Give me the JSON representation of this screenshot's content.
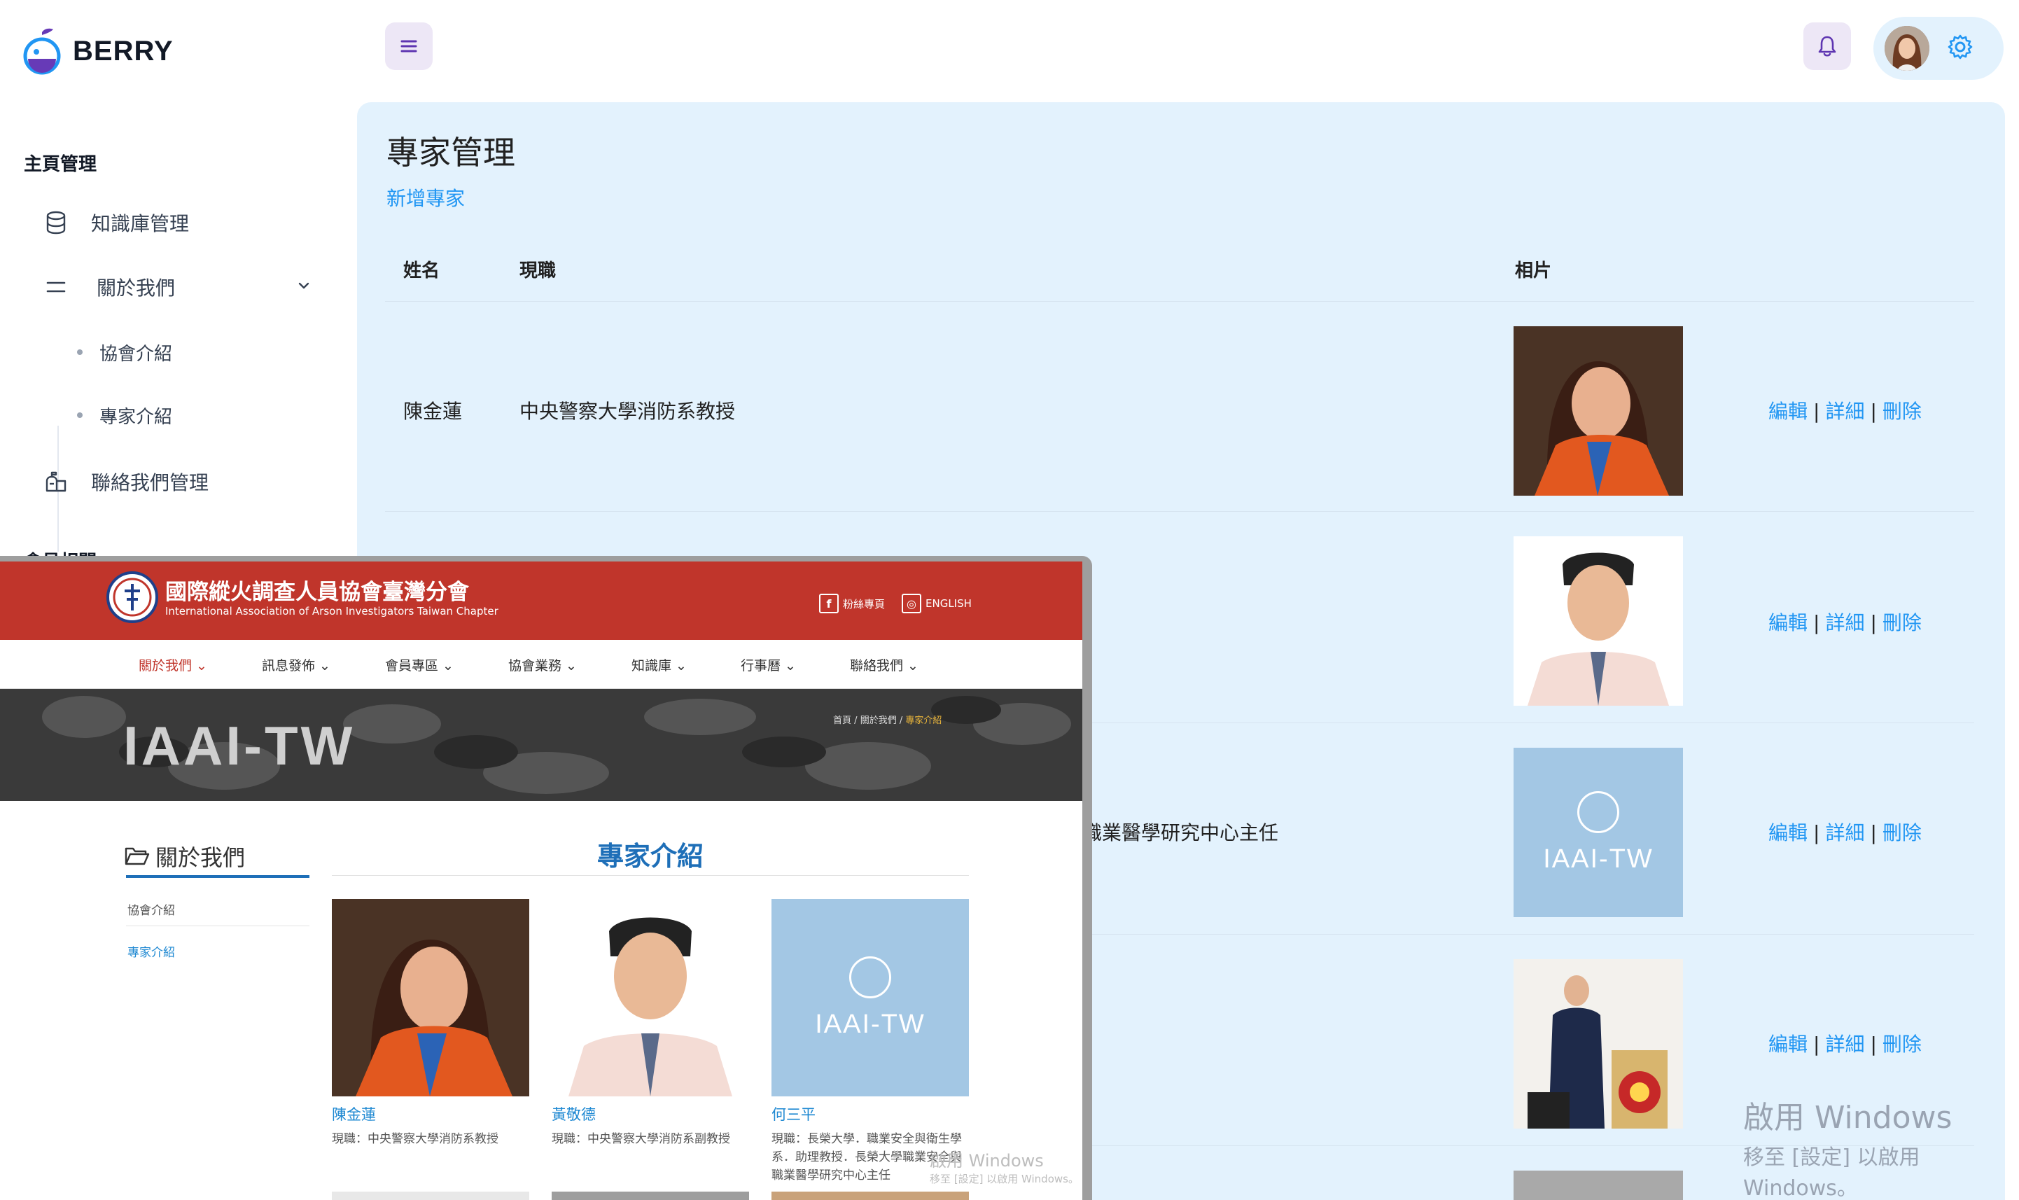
{
  "app": {
    "brand": "BERRY"
  },
  "sidebar": {
    "heading_home": "主頁管理",
    "items": [
      {
        "label": "知識庫管理",
        "icon": "database-icon"
      },
      {
        "label": "關於我們",
        "icon": "menu-lines-icon"
      },
      {
        "label": "聯絡我們管理",
        "icon": "mailbox-icon"
      }
    ],
    "sub_items": [
      {
        "label": "協會介紹"
      },
      {
        "label": "專家介紹"
      }
    ],
    "heading_member": "會員相關"
  },
  "main": {
    "title": "專家管理",
    "add_link": "新增專家",
    "columns": {
      "name": "姓名",
      "position": "現職",
      "photo": "相片"
    },
    "rows": [
      {
        "name": "陳金蓮",
        "position": "中央警察大學消防系教授",
        "photo": "woman-in-orange-vest"
      },
      {
        "name": "",
        "position": "",
        "photo": "man-in-shirt-and-tie"
      },
      {
        "name": "",
        "position": "職業醫學研究中心主任",
        "photo": "iaai-tw-logo"
      },
      {
        "name": "",
        "position": "",
        "photo": "officer-in-uniform"
      },
      {
        "name": "",
        "position": "",
        "photo": "grey-placeholder"
      }
    ],
    "actions": {
      "edit": "編輯",
      "detail": "詳細",
      "delete": "刪除",
      "sep": "|"
    },
    "watermark": {
      "line1": "啟用 Windows",
      "line2": "移至 [設定] 以啟用 Windows。"
    }
  },
  "overlay": {
    "site_title": "國際縱火調查人員協會臺灣分會",
    "site_subtitle": "International Association of Arson Investigators Taiwan Chapter",
    "toplinks": [
      {
        "icon": "f",
        "label": "粉絲專頁"
      },
      {
        "icon": "◎",
        "label": "ENGLISH"
      }
    ],
    "nav": [
      "關於我們",
      "訊息發佈",
      "會員專區",
      "協會業務",
      "知識庫",
      "行事曆",
      "聯絡我們"
    ],
    "banner_text": "IAAI-TW",
    "breadcrumb": {
      "home": "首頁",
      "sep": "/",
      "parent": "關於我們",
      "current": "專家介紹"
    },
    "side_title": "關於我們",
    "side_links": [
      "協會介紹",
      "專家介紹"
    ],
    "section_title": "專家介紹",
    "cards": [
      {
        "name": "陳金蓮",
        "job": "現職：中央警察大學消防系教授"
      },
      {
        "name": "黃敬德",
        "job": "現職：中央警察大學消防系副教授"
      },
      {
        "name": "何三平",
        "job": "現職：長榮大學．職業安全與衛生學系．助理教授．長榮大學職業安全與職業醫學研究中心主任",
        "logo_word": "IAAI-TW"
      }
    ],
    "watermark": {
      "line1": "啟用 Windows",
      "line2": "移至 [設定] 以啟用 Windows。"
    }
  },
  "colors": {
    "accent": "#2196f3",
    "panel_bg": "#e3f2fd",
    "chip_purple": "#ede7f6",
    "iaai_red": "#c0352b",
    "iaai_blue": "#1e6fb8"
  }
}
